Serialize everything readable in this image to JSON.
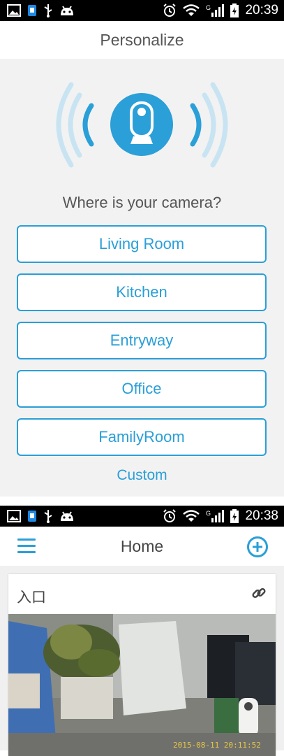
{
  "screen_top": {
    "status": {
      "time": "20:39",
      "network": "G"
    },
    "title": "Personalize",
    "prompt": "Where is your camera?",
    "options": [
      "Living Room",
      "Kitchen",
      "Entryway",
      "Office",
      "FamilyRoom"
    ],
    "custom_label": "Custom"
  },
  "screen_bottom": {
    "status": {
      "time": "20:38",
      "network": "G"
    },
    "title": "Home",
    "card": {
      "name": "入口",
      "timestamp": "2015-08-11 20:11:52"
    }
  },
  "colors": {
    "accent": "#2a9fd8",
    "light_wave": "#c8e4f3",
    "panel_bg": "#f2f2f2",
    "status_bar": "#000000"
  },
  "icons": [
    "gallery-icon",
    "sim-icon",
    "usb-icon",
    "android-icon",
    "alarm-icon",
    "wifi-icon",
    "signal-icon",
    "battery-icon",
    "camera-icon",
    "menu-icon",
    "add-icon",
    "link-icon"
  ]
}
